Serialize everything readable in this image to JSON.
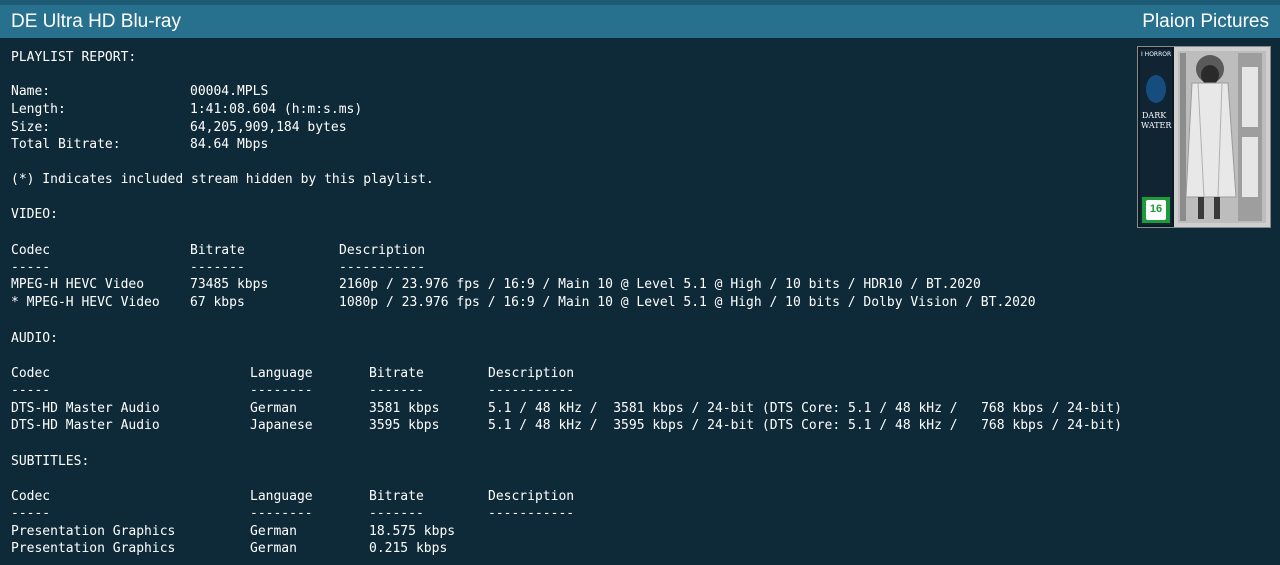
{
  "header": {
    "title": "DE Ultra HD Blu-ray",
    "studio": "Plaion Pictures"
  },
  "report": {
    "heading": "PLAYLIST REPORT:",
    "info": [
      {
        "label": "Name:",
        "value": "00004.MPLS"
      },
      {
        "label": "Length:",
        "value": "1:41:08.604 (h:m:s.ms)"
      },
      {
        "label": "Size:",
        "value": "64,205,909,184 bytes"
      },
      {
        "label": "Total Bitrate:",
        "value": "84.64 Mbps"
      }
    ],
    "note": "(*) Indicates included stream hidden by this playlist.",
    "video": {
      "heading": "VIDEO:",
      "headers": [
        "Codec",
        "Bitrate",
        "Description"
      ],
      "dashes": [
        "-----",
        "-------",
        "-----------"
      ],
      "rows": [
        [
          "MPEG-H HEVC Video",
          "73485 kbps",
          "2160p / 23.976 fps / 16:9 / Main 10 @ Level 5.1 @ High / 10 bits / HDR10 / BT.2020"
        ],
        [
          "* MPEG-H HEVC Video",
          "67 kbps",
          "1080p / 23.976 fps / 16:9 / Main 10 @ Level 5.1 @ High / 10 bits / Dolby Vision / BT.2020"
        ]
      ]
    },
    "audio": {
      "heading": "AUDIO:",
      "headers": [
        "Codec",
        "Language",
        "Bitrate",
        "Description"
      ],
      "dashes": [
        "-----",
        "--------",
        "-------",
        "-----------"
      ],
      "rows": [
        [
          "DTS-HD Master Audio",
          "German",
          "3581 kbps",
          "5.1 / 48 kHz /  3581 kbps / 24-bit (DTS Core: 5.1 / 48 kHz /   768 kbps / 24-bit)"
        ],
        [
          "DTS-HD Master Audio",
          "Japanese",
          "3595 kbps",
          "5.1 / 48 kHz /  3595 kbps / 24-bit (DTS Core: 5.1 / 48 kHz /   768 kbps / 24-bit)"
        ]
      ]
    },
    "subtitles": {
      "heading": "SUBTITLES:",
      "headers": [
        "Codec",
        "Language",
        "Bitrate",
        "Description"
      ],
      "dashes": [
        "-----",
        "--------",
        "-------",
        "-----------"
      ],
      "rows": [
        [
          "Presentation Graphics",
          "German",
          "18.575 kbps",
          ""
        ],
        [
          "Presentation Graphics",
          "German",
          "0.215 kbps",
          ""
        ]
      ]
    }
  },
  "cover": {
    "top_text": "I HORROR",
    "title_line1": "DARK",
    "title_line2": "WATER",
    "fsk": "16",
    "colors": {
      "accent": "#1e6ebe",
      "fsk_green": "#1e9a3a"
    }
  }
}
